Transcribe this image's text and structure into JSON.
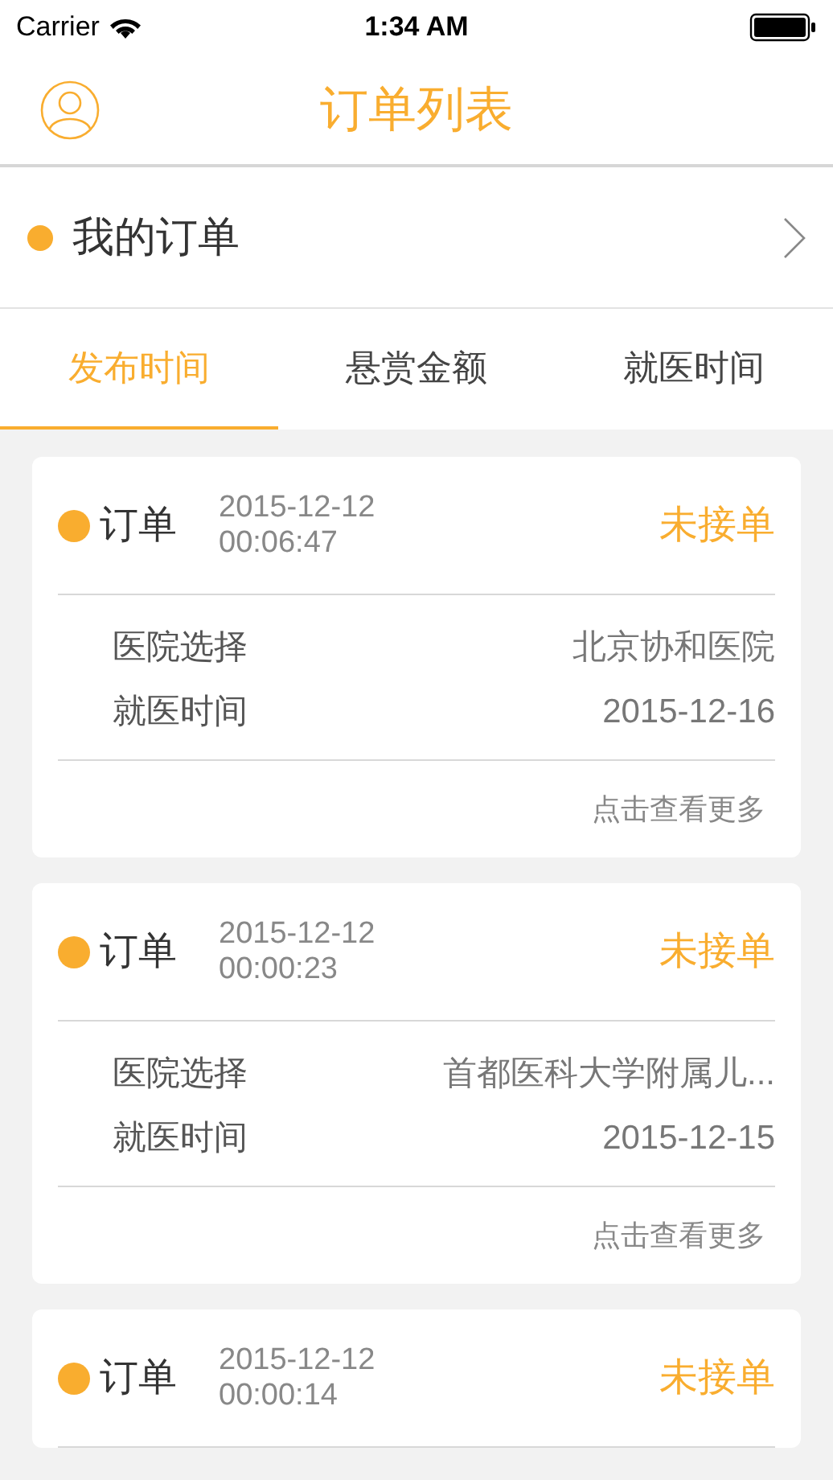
{
  "status_bar": {
    "carrier": "Carrier",
    "time": "1:34 AM"
  },
  "nav": {
    "title": "订单列表"
  },
  "my_orders": {
    "label": "我的订单"
  },
  "tabs": [
    {
      "label": "发布时间",
      "selected": true
    },
    {
      "label": "悬赏金额",
      "selected": false
    },
    {
      "label": "就医时间",
      "selected": false
    }
  ],
  "orders": [
    {
      "title": "订单",
      "date": "2015-12-12",
      "time": "00:06:47",
      "status": "未接单",
      "fields": [
        {
          "label": "医院选择",
          "value": "北京协和医院"
        },
        {
          "label": "就医时间",
          "value": "2015-12-16"
        }
      ],
      "more": "点击查看更多"
    },
    {
      "title": "订单",
      "date": "2015-12-12",
      "time": "00:00:23",
      "status": "未接单",
      "fields": [
        {
          "label": "医院选择",
          "value": "首都医科大学附属儿..."
        },
        {
          "label": "就医时间",
          "value": "2015-12-15"
        }
      ],
      "more": "点击查看更多"
    },
    {
      "title": "订单",
      "date": "2015-12-12",
      "time": "00:00:14",
      "status": "未接单"
    }
  ]
}
